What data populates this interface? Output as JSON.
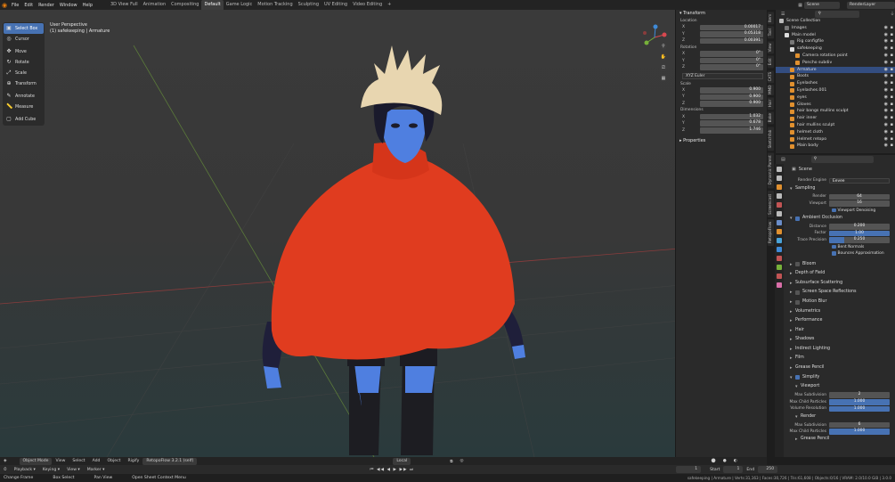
{
  "topbar": {
    "menu": [
      "File",
      "Edit",
      "Render",
      "Window",
      "Help"
    ],
    "workspaces": [
      "3D View Full",
      "Animation",
      "Compositing",
      "Default",
      "Game Logic",
      "Motion Tracking",
      "Sculpting",
      "UV Editing",
      "Video Editing"
    ],
    "active_workspace": "Default",
    "add_tab": "+",
    "scene": "Scene",
    "view_layer": "RenderLayer"
  },
  "toolbar": {
    "tools": [
      {
        "label": "Select Box",
        "icon": "select-box-icon",
        "glyph": "▣"
      },
      {
        "label": "Cursor",
        "icon": "cursor-icon",
        "glyph": "◎"
      },
      {
        "label": "Move",
        "icon": "move-icon",
        "glyph": "✥"
      },
      {
        "label": "Rotate",
        "icon": "rotate-icon",
        "glyph": "↻"
      },
      {
        "label": "Scale",
        "icon": "scale-icon",
        "glyph": "⤢"
      },
      {
        "label": "Transform",
        "icon": "transform-icon",
        "glyph": "⊕"
      },
      {
        "label": "Annotate",
        "icon": "annotate-icon",
        "glyph": "✎"
      },
      {
        "label": "Measure",
        "icon": "measure-icon",
        "glyph": "📏"
      },
      {
        "label": "Add Cube",
        "icon": "add-cube-icon",
        "glyph": "▢"
      }
    ]
  },
  "viewport": {
    "perspective": "User Perspective",
    "context": "(1) safekeeping | Armature"
  },
  "npanel": {
    "header": "Transform",
    "location_label": "Location",
    "location": [
      {
        "ax": "X",
        "v": "0.00017"
      },
      {
        "ax": "Y",
        "v": "0.05318"
      },
      {
        "ax": "Z",
        "v": "0.00391"
      }
    ],
    "rotation_label": "Rotation",
    "rotation": [
      {
        "ax": "X",
        "v": "0°"
      },
      {
        "ax": "Y",
        "v": "0°"
      },
      {
        "ax": "Z",
        "v": "0°"
      }
    ],
    "rotation_mode": "XYZ Euler",
    "scale_label": "Scale",
    "scale": [
      {
        "ax": "X",
        "v": "0.900"
      },
      {
        "ax": "Y",
        "v": "0.900"
      },
      {
        "ax": "Z",
        "v": "0.900"
      }
    ],
    "dimensions_label": "Dimensions",
    "dimensions": [
      {
        "ax": "X",
        "v": "1.032"
      },
      {
        "ax": "Y",
        "v": "0.678"
      },
      {
        "ax": "Z",
        "v": "1.746"
      }
    ],
    "properties_label": "Properties",
    "tabs": [
      "Item",
      "Tool",
      "View",
      "Edit",
      "CATS",
      "MMD",
      "Hair",
      "Bake",
      "Sketchfab",
      "Dynamic Parent",
      "Screencast",
      "RetopoFlow"
    ]
  },
  "outliner": {
    "rows": [
      {
        "label": "Scene Collection",
        "indent": 0,
        "color": "#bbbbbb",
        "sel": false
      },
      {
        "label": "Images",
        "indent": 1,
        "color": "#777777",
        "sel": false
      },
      {
        "label": "Main model",
        "indent": 1,
        "color": "#dddddd",
        "sel": false
      },
      {
        "label": "Rig configfile",
        "indent": 2,
        "color": "#777777",
        "sel": false
      },
      {
        "label": "safekeeping",
        "indent": 2,
        "color": "#dddddd",
        "sel": false
      },
      {
        "label": "Camera rotation point",
        "indent": 3,
        "color": "#e0902f",
        "sel": false
      },
      {
        "label": "Poncho subdiv",
        "indent": 3,
        "color": "#e0902f",
        "sel": false
      },
      {
        "label": "Armature",
        "indent": 2,
        "color": "#e0902f",
        "sel": true
      },
      {
        "label": "Boots",
        "indent": 2,
        "color": "#e0902f",
        "sel": false
      },
      {
        "label": "Eyelashes",
        "indent": 2,
        "color": "#e0902f",
        "sel": false
      },
      {
        "label": "Eyelashes.001",
        "indent": 2,
        "color": "#e0902f",
        "sel": false
      },
      {
        "label": "eyes",
        "indent": 2,
        "color": "#e0902f",
        "sel": false
      },
      {
        "label": "Gloves",
        "indent": 2,
        "color": "#e0902f",
        "sel": false
      },
      {
        "label": "hair bangs mullins sculpt",
        "indent": 2,
        "color": "#e0902f",
        "sel": false
      },
      {
        "label": "hair inner",
        "indent": 2,
        "color": "#e0902f",
        "sel": false
      },
      {
        "label": "hair mullins sculpt",
        "indent": 2,
        "color": "#e0902f",
        "sel": false
      },
      {
        "label": "helmet cloth",
        "indent": 2,
        "color": "#e0902f",
        "sel": false
      },
      {
        "label": "Helmet retopo",
        "indent": 2,
        "color": "#e0902f",
        "sel": false
      },
      {
        "label": "Main body",
        "indent": 2,
        "color": "#e0902f",
        "sel": false
      }
    ]
  },
  "props": {
    "scene": "Scene",
    "render_engine_label": "Render Engine",
    "render_engine": "Eevee",
    "sampling": "Sampling",
    "render_label": "Render",
    "render_val": "64",
    "viewport_label": "Viewport",
    "viewport_val": "16",
    "viewport_denoising": "Viewport Denoising",
    "ao": "Ambient Occlusion",
    "distance_label": "Distance",
    "distance": "0.200",
    "factor_label": "Factor",
    "factor": "1.00",
    "trace_label": "Trace Precision",
    "trace": "0.250",
    "bent_normals": "Bent Normals",
    "bounces": "Bounces Approximation",
    "sections": [
      {
        "label": "Bloom",
        "cb": true
      },
      {
        "label": "Depth of Field",
        "cb": false
      },
      {
        "label": "Subsurface Scattering",
        "cb": false
      },
      {
        "label": "Screen Space Reflections",
        "cb": true
      },
      {
        "label": "Motion Blur",
        "cb": true
      },
      {
        "label": "Volumetrics",
        "cb": false
      },
      {
        "label": "Performance",
        "cb": false
      },
      {
        "label": "Hair",
        "cb": false
      },
      {
        "label": "Shadows",
        "cb": false
      },
      {
        "label": "Indirect Lighting",
        "cb": false
      },
      {
        "label": "Film",
        "cb": false
      },
      {
        "label": "Grease Pencil",
        "cb": false
      }
    ],
    "simplify": "Simplify",
    "simplify_viewport": "Viewport",
    "max_subdiv_label": "Max Subdivision",
    "max_subdiv_vp": "2",
    "max_child_label": "Max Child Particles",
    "max_child_vp": "1.000",
    "vol_res_label": "Volume Resolution",
    "vol_res": "1.000",
    "simplify_render": "Render",
    "max_subdiv_r": "6",
    "max_child_r": "1.000",
    "grease_pencil2": "Grease Pencil"
  },
  "vp_header": {
    "mode": "Object Mode",
    "menu": [
      "View",
      "Select",
      "Add",
      "Object",
      "Rigify"
    ],
    "addon": "RetopoFlow 3.2.1 (self)",
    "transform": "Local"
  },
  "timeline": {
    "menu": [
      "Playback",
      "Keying",
      "View",
      "Marker"
    ],
    "frame": "1",
    "start_label": "Start",
    "start": "1",
    "end_label": "End",
    "end": "250"
  },
  "status": {
    "items": [
      "Change Frame",
      "Box Select",
      "Pan View",
      "Open Sheet Context Menu"
    ],
    "stats": "safekeeping | Armature | Verts:31,163 | Faces:30,726 | Tris:61,608 | Objects:0/16 | VRAM: 2.0/10.0 GiB | 3.0.0"
  },
  "colors": {
    "accent": "#4772b3",
    "poncho": "#e03c1f",
    "skin": "#4f7fe0",
    "hat": "#e8d6b0"
  }
}
